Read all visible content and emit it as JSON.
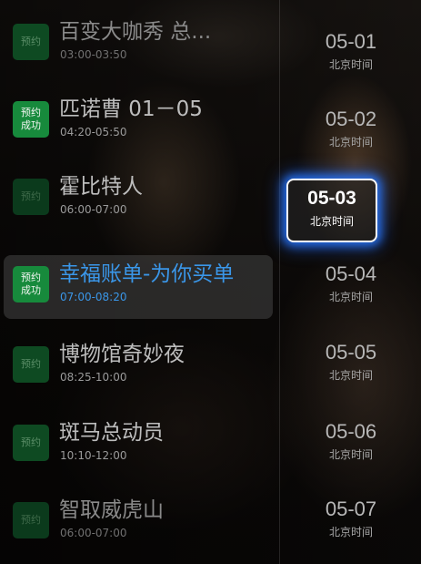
{
  "programs": [
    {
      "title": "百变大咖秀 总...",
      "time": "03:00-03:50",
      "badge": "预约"
    },
    {
      "title": "匹诺曹 01－05",
      "time": "04:20-05:50",
      "badge": "预约\n成功"
    },
    {
      "title": "霍比特人",
      "time": "06:00-07:00",
      "badge": "预约"
    },
    {
      "title": "幸福账单-为你买单",
      "time": "07:00-08:20",
      "badge": "预约\n成功"
    },
    {
      "title": "博物馆奇妙夜",
      "time": "08:25-10:00",
      "badge": "预约"
    },
    {
      "title": "斑马总动员",
      "time": "10:10-12:00",
      "badge": "预约"
    },
    {
      "title": "智取威虎山",
      "time": "06:00-07:00",
      "badge": "预约"
    }
  ],
  "dates": [
    {
      "date": "05-01",
      "tz": "北京时间"
    },
    {
      "date": "05-02",
      "tz": "北京时间"
    },
    {
      "date": "05-03",
      "tz": "北京时间"
    },
    {
      "date": "05-04",
      "tz": "北京时间"
    },
    {
      "date": "05-05",
      "tz": "北京时间"
    },
    {
      "date": "05-06",
      "tz": "北京时间"
    },
    {
      "date": "05-07",
      "tz": "北京时间"
    }
  ],
  "colors": {
    "badge_green": "#178a3c",
    "selected_title_blue": "#3a96e8",
    "focus_glow": "#2878ff"
  }
}
